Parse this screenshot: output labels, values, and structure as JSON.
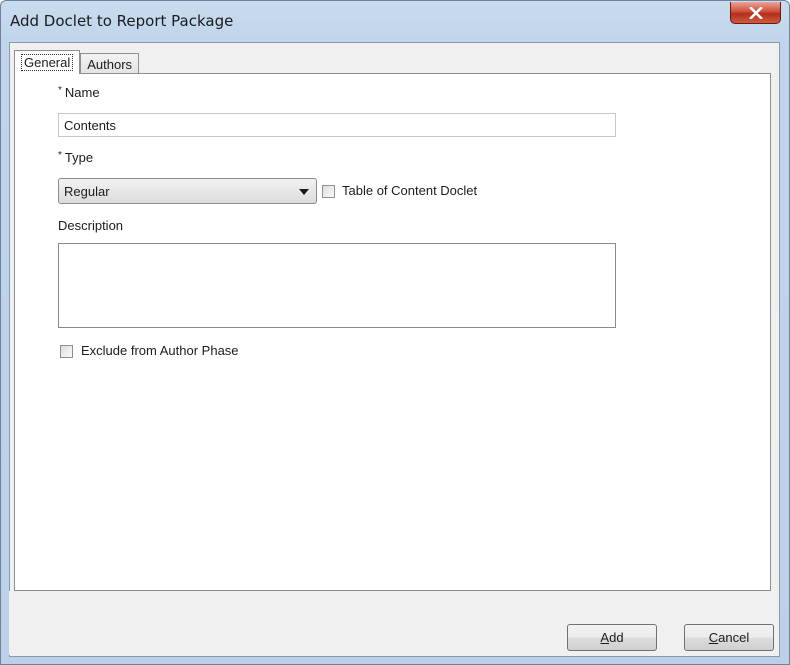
{
  "window": {
    "title": "Add Doclet to Report Package",
    "close_icon": "x-icon"
  },
  "tabs": [
    {
      "label": "General",
      "active": true
    },
    {
      "label": "Authors",
      "active": false
    }
  ],
  "form": {
    "name_required_marker": "*",
    "name_label": "Name",
    "name_value": "Contents",
    "type_required_marker": "*",
    "type_label": "Type",
    "type_selected": "Regular",
    "toc_checkbox_label": "Table of Content Doclet",
    "toc_checked": false,
    "description_label": "Description",
    "description_value": "",
    "exclude_checkbox_label": "Exclude from Author Phase",
    "exclude_checked": false
  },
  "buttons": {
    "add_label_mnemonic": "A",
    "add_label_rest": "dd",
    "cancel_label_mnemonic": "C",
    "cancel_label_rest": "ancel"
  },
  "colors": {
    "title_bar": "#c0d5ec",
    "close_button": "#c9462f"
  }
}
